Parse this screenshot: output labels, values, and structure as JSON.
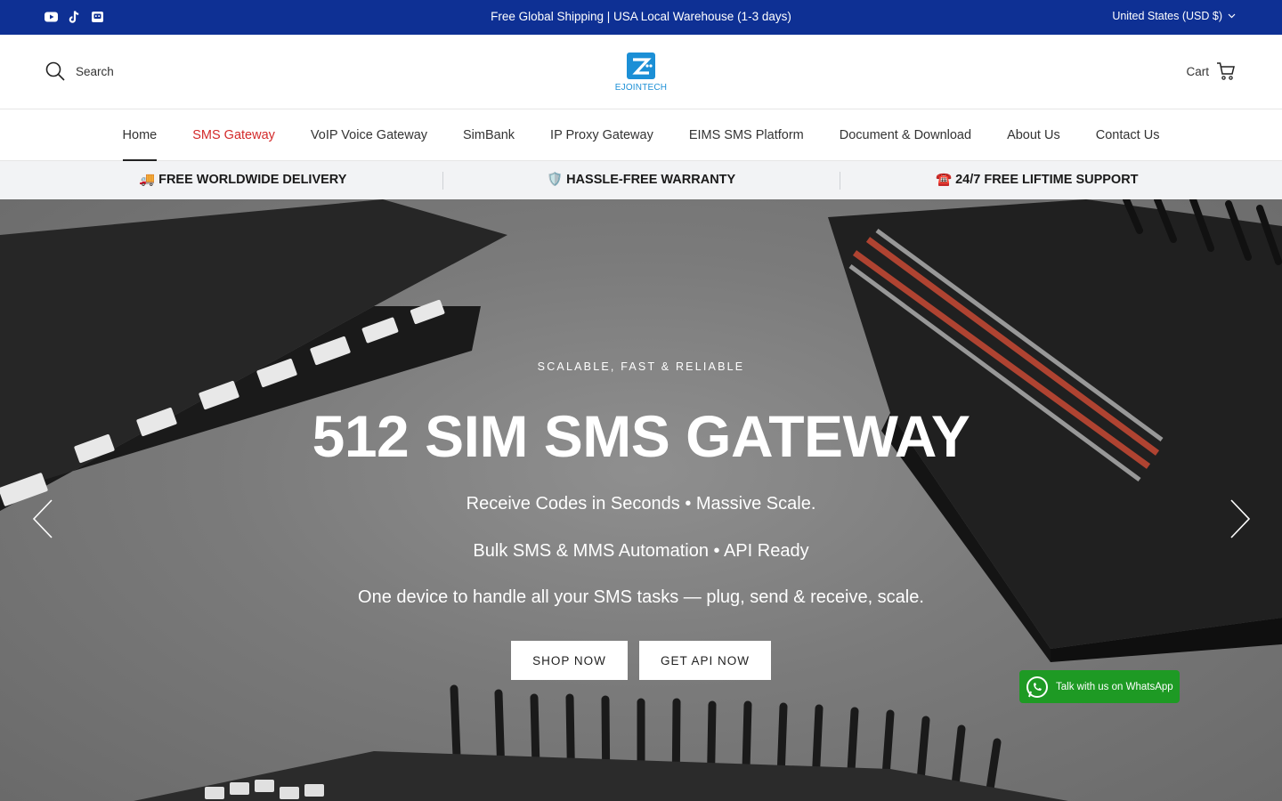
{
  "topbar": {
    "announcement": "Free Global Shipping | USA Local Warehouse (1-3 days)",
    "currency": "United States (USD $)",
    "social_icons": [
      "youtube-icon",
      "tiktok-icon",
      "discord-icon"
    ]
  },
  "header": {
    "search_label": "Search",
    "logo_text": "EJOINTECH",
    "cart_label": "Cart"
  },
  "nav": {
    "items": [
      {
        "label": "Home",
        "state": "active"
      },
      {
        "label": "SMS Gateway",
        "state": "highlight"
      },
      {
        "label": "VoIP Voice Gateway"
      },
      {
        "label": "SimBank"
      },
      {
        "label": "IP Proxy Gateway"
      },
      {
        "label": "EIMS SMS Platform"
      },
      {
        "label": "Document & Download"
      },
      {
        "label": "About Us"
      },
      {
        "label": "Contact Us"
      }
    ]
  },
  "features": {
    "delivery": "🚚 FREE WORLDWIDE DELIVERY",
    "warranty": "🛡️ HASSLE-FREE WARRANTY",
    "support": "☎️ 24/7 FREE LIFTIME SUPPORT"
  },
  "hero": {
    "eyebrow": "SCALABLE, FAST & RELIABLE",
    "headline": "512 SIM SMS GATEWAY",
    "line1": "Receive Codes in Seconds • Massive Scale.",
    "line2": "Bulk SMS & MMS Automation • API Ready",
    "line3": "One device to handle all your SMS tasks — plug, send & receive, scale.",
    "shop_button": "SHOP NOW",
    "api_button": "GET API NOW"
  },
  "whatsapp": {
    "label": "Talk with us on WhatsApp"
  },
  "colors": {
    "topbar": "#0e3094",
    "accent_red": "#d32a2a",
    "whatsapp_green": "#1e9a24",
    "logo_blue": "#1b8fd6"
  }
}
